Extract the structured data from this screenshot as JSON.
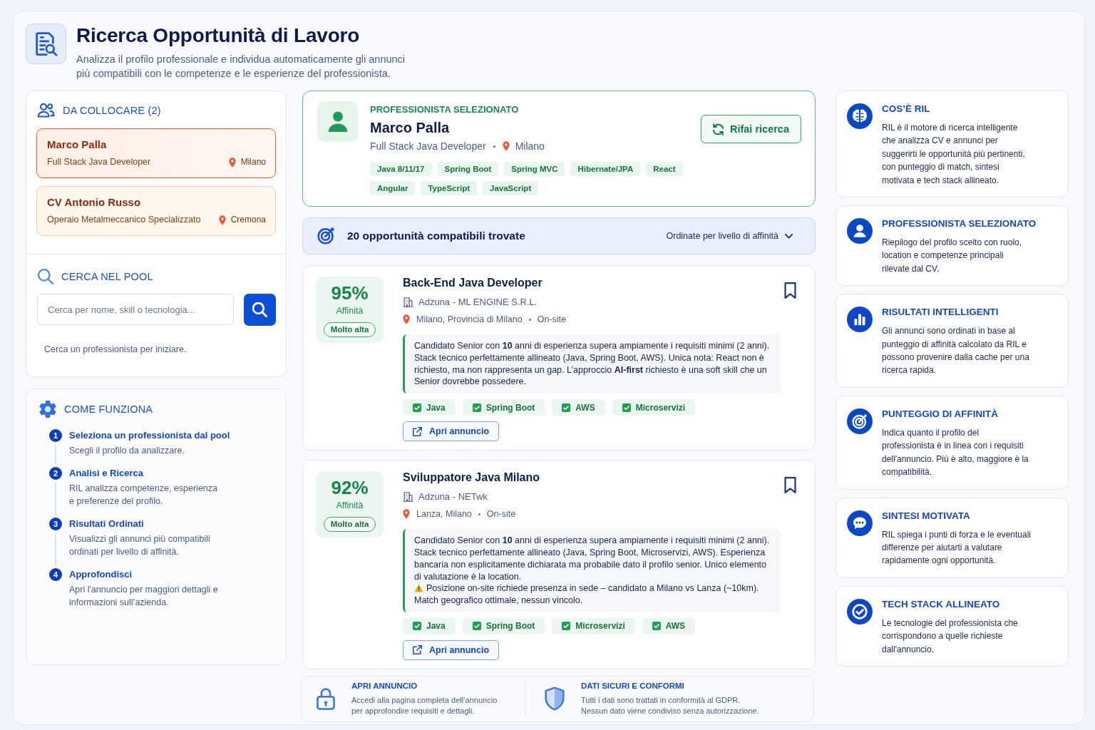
{
  "header": {
    "title": "Ricerca Opportunità di Lavoro",
    "subtitle": "Analizza il profilo professionale e individua automaticamente gli annunci più compatibili con le competenze e le esperienze del professionista."
  },
  "candidates": {
    "title": "DA COLLOCARE (2)",
    "items": [
      {
        "name": "Marco Palla",
        "role": "Full Stack Java Developer",
        "location": "Milano",
        "selected": true
      },
      {
        "name": "CV Antonio Russo",
        "role": "Operaio Metalmeccanico Specializzato",
        "location": "Cremona",
        "selected": false
      }
    ]
  },
  "pool_search": {
    "title": "CERCA NEL POOL",
    "placeholder": "Cerca per nome, skill o tecnologia...",
    "hint": "Cerca un professionista per iniziare."
  },
  "how_it_works": {
    "title": "COME FUNZIONA",
    "steps": [
      {
        "number": "1",
        "title": "Seleziona un professionista dal pool",
        "description": "Scegli il profilo da analizzare."
      },
      {
        "number": "2",
        "title": "Analisi e Ricerca",
        "description": "RIL analizza competenze, esperienza e preferenze del profilo."
      },
      {
        "number": "3",
        "title": "Risultati Ordinati",
        "description": "Visualizzi gli annunci più compatibili ordinati per livello di affinità."
      },
      {
        "number": "4",
        "title": "Approfondisci",
        "description": "Apri l'annuncio per maggiori dettagli e informazioni sull’azienda."
      }
    ]
  },
  "selected_profile": {
    "label": "PROFESSIONISTA SELEZIONATO",
    "name": "Marco Palla",
    "role": "Full Stack Java Developer",
    "location": "Milano",
    "skills": [
      "Java 8/11/17",
      "Spring Boot",
      "Spring MVC",
      "Hibernate/JPA",
      "React",
      "Angular",
      "TypeScript",
      "JavaScript"
    ],
    "button": "Rifai ricerca"
  },
  "results": {
    "count_text": "20 opportunità compatibili trovate",
    "sort_label": "Ordinate per livello di affinità"
  },
  "jobs": [
    {
      "score": "95%",
      "score_label": "Affinità",
      "level_label": "Molto alta",
      "title": "Back-End Java Developer",
      "company": "Adzuna - ML ENGINE S.R.L.",
      "location": "Milano, Provincia di Milano",
      "work_mode": "On-site",
      "summary": [
        {
          "kind": "text",
          "text": "Candidato Senior con **10** anni di esperienza supera ampiamente i requisiti minimi (2 anni). Stack tecnico perfettamente allineato (Java, Spring Boot, AWS). Unica nota: React non è richiesto, ma non rappresenta un gap. L’approccio **AI-first** richiesto è una soft skill che un Senior dovrebbe possedere."
        }
      ],
      "skills": [
        "Java",
        "Spring Boot",
        "AWS",
        "Microservizi"
      ],
      "button": "Apri annuncio"
    },
    {
      "score": "92%",
      "score_label": "Affinità",
      "level_label": "Molto alta",
      "title": "Sviluppatore Java Milano",
      "company": "Adzuna - NETwk",
      "location": "Lanza, Milano",
      "work_mode": "On-site",
      "summary": [
        {
          "kind": "text",
          "text": "Candidato Senior con **10** anni di esperienza supera ampiamente i requisiti minimi (2 anni). Stack tecnico perfettamente allineato (Java, Spring Boot, Microservizi, AWS). Esperienza bancaria non esplicitamente dichiarata ma probabile dato il profilo senior. Unico elemento di valutazione è la location."
        },
        {
          "kind": "warning",
          "text": "Posizione on-site richiede presenza in sede – candidato a Milano vs Lanza (~10km)."
        },
        {
          "kind": "text",
          "text": "Match geografico ottimale, nessun vincolo."
        }
      ],
      "skills": [
        "Java",
        "Spring Boot",
        "Microservizi",
        "AWS"
      ],
      "button": "Apri annuncio"
    }
  ],
  "footer_info": [
    {
      "title": "APRI ANNUNCIO",
      "text": "Accedi alla pagina completa dell’annuncio per approfondire requisiti e dettagli."
    },
    {
      "title": "DATI SICURI E CONFORMI",
      "text": "Tutti i dati sono trattati in conformità al GDPR. Nessun dato viene condiviso senza autorizzazione."
    }
  ],
  "info_cards": [
    {
      "title": "COS’È RIL",
      "text": "RIL è il motore di ricerca intelligente che analizza CV e annunci per suggerirti le opportunità più pertinenti, con punteggio di match, sintesi motivata e tech stack allineato."
    },
    {
      "title": "PROFESSIONISTA SELEZIONATO",
      "text": "Riepilogo del profilo scelto con ruolo, location e competenze principali rilevate dal CV."
    },
    {
      "title": "RISULTATI INTELLIGENTI",
      "text": "Gli annunci sono ordinati in base al punteggio di affinità calcolato da RIL e possono provenire dalla cache per una ricerca rapida."
    },
    {
      "title": "PUNTEGGIO DI AFFINITÀ",
      "text": "Indica quanto il profilo del professionista è in linea con i requisiti dell'annuncio. Più è alto, maggiore è la compatibilità."
    },
    {
      "title": "SINTESI MOTIVATA",
      "text": "RIL spiega i punti di forza e le eventuali differenze per aiutarti a valutare rapidamente ogni opportunità."
    },
    {
      "title": "TECH STACK ALLINEATO",
      "text": "Le tecnologie del professionista che corrispondono a quelle richieste dall'annuncio."
    }
  ]
}
